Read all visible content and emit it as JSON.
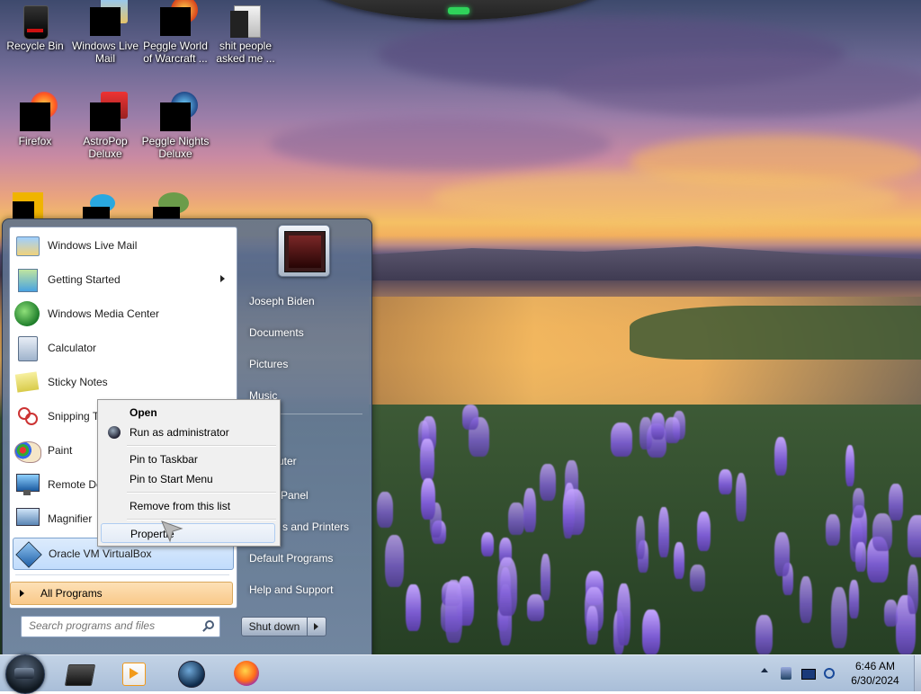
{
  "desktop": {
    "icons": [
      {
        "label": "Recycle Bin"
      },
      {
        "label": "Windows Live Mail"
      },
      {
        "label": "Peggle World of Warcraft ..."
      },
      {
        "label": "shit people asked me ..."
      },
      {
        "label": "Firefox"
      },
      {
        "label": "AstroPop Deluxe"
      },
      {
        "label": "Peggle Nights Deluxe"
      }
    ]
  },
  "start_menu": {
    "programs": [
      {
        "label": "Windows Live Mail",
        "icon": "mail-icon"
      },
      {
        "label": "Getting Started",
        "icon": "getting-started-icon"
      },
      {
        "label": "Windows Media Center",
        "icon": "media-center-icon"
      },
      {
        "label": "Calculator",
        "icon": "calculator-icon"
      },
      {
        "label": "Sticky Notes",
        "icon": "sticky-notes-icon"
      },
      {
        "label": "Snipping T",
        "icon": "scissors-icon"
      },
      {
        "label": "Paint",
        "icon": "paint-icon"
      },
      {
        "label": "Remote De",
        "icon": "remote-desktop-icon"
      },
      {
        "label": "Magnifier",
        "icon": "magnifier-icon"
      },
      {
        "label": "Oracle VM VirtualBox",
        "icon": "virtualbox-icon"
      }
    ],
    "all_programs": "All Programs",
    "search_placeholder": "Search programs and files",
    "right_items": [
      "Joseph Biden",
      "Documents",
      "Pictures",
      "Music",
      "uter",
      "l Panel",
      "s and Printers",
      "Default Programs",
      "Help and Support"
    ],
    "shutdown_label": "Shut down"
  },
  "context_menu": {
    "items": [
      "Open",
      "Run as administrator",
      "Pin to Taskbar",
      "Pin to Start Menu",
      "Remove from this list",
      "Propertie"
    ]
  },
  "taskbar": {
    "pinned": [
      "media-player-icon",
      "folder-icon",
      "globe-icon",
      "firefox-icon"
    ],
    "clock_time": "6:46 AM",
    "clock_date": "6/30/2024"
  }
}
